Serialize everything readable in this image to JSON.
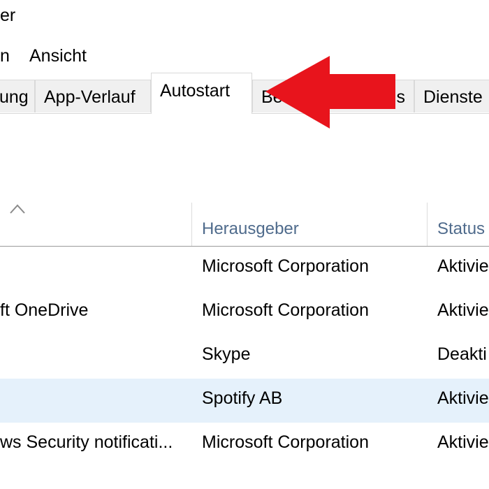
{
  "window": {
    "title_fragment": "er"
  },
  "menu": {
    "items": [
      {
        "label": "n"
      },
      {
        "label": "Ansicht"
      }
    ]
  },
  "tabs": [
    {
      "label": "ung",
      "active": false
    },
    {
      "label": "App-Verlauf",
      "active": false
    },
    {
      "label": "Autostart",
      "active": true
    },
    {
      "label": "Be",
      "active": false
    },
    {
      "label": "ls",
      "active": false
    },
    {
      "label": "Dienste",
      "active": false
    }
  ],
  "annotation": {
    "arrow_color": "#e8141c",
    "arrow_icon": "arrow-left-icon"
  },
  "columns": {
    "sort_icon": "sort-ascending-icon",
    "publisher": "Herausgeber",
    "status": "Status"
  },
  "rows": [
    {
      "name": "",
      "publisher": "Microsoft Corporation",
      "status": "Aktivie",
      "selected": false
    },
    {
      "name": "ft OneDrive",
      "publisher": "Microsoft Corporation",
      "status": "Aktivie",
      "selected": false
    },
    {
      "name": "",
      "publisher": "Skype",
      "status": "Deakti",
      "selected": false
    },
    {
      "name": "",
      "publisher": "Spotify AB",
      "status": "Aktivie",
      "selected": true
    },
    {
      "name": "ws Security notificati...",
      "publisher": "Microsoft Corporation",
      "status": "Aktivie",
      "selected": false
    }
  ],
  "colors": {
    "selection": "#e5f1fb",
    "header_text": "#4f6b8c",
    "tab_inactive": "#f0f0f0"
  }
}
